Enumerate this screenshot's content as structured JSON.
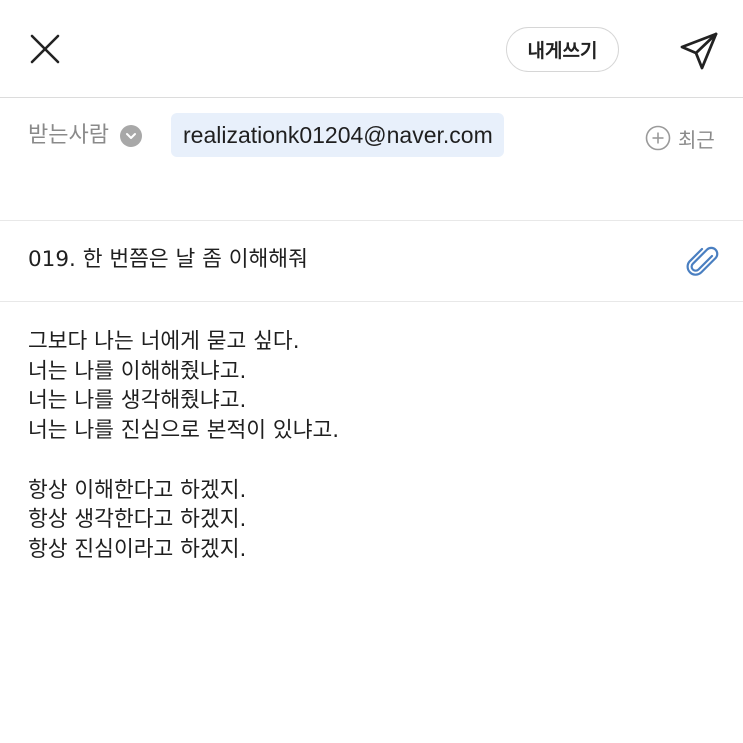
{
  "topbar": {
    "close_icon": "close-icon",
    "self_mail_label": "내게쓰기",
    "send_icon": "send-icon"
  },
  "recipient": {
    "label": "받는사람",
    "toggle_icon": "chevron-down-circle-icon",
    "address": "realizationk01204@naver.com",
    "recent_icon": "plus-circle-icon",
    "recent_label": "최근"
  },
  "subject": {
    "text": "019. 한 번쯤은 날 좀 이해해줘",
    "attach_icon": "paperclip-icon"
  },
  "body": {
    "lines": [
      "그보다 나는 너에게 묻고 싶다.",
      "너는 나를 이해해줬냐고.",
      "너는 나를 생각해줬냐고.",
      "너는 나를 진심으로 본적이 있냐고.",
      "",
      "항상 이해한다고 하겠지.",
      "항상 생각한다고 하겠지.",
      "항상 진심이라고 하겠지."
    ]
  },
  "colors": {
    "chip_background": "#e8f0fb",
    "attach_icon": "#4a7fc1",
    "muted_text": "#8a8a8a"
  }
}
